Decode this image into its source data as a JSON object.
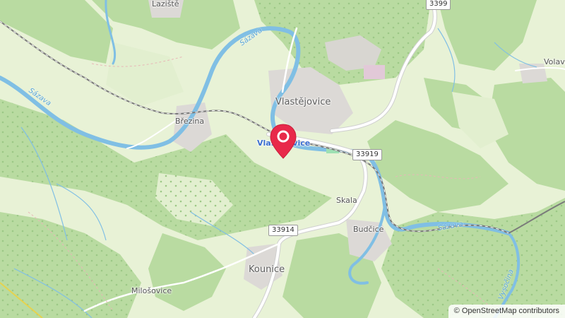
{
  "labels": {
    "lazite": "Laziště",
    "brezina": "Březina",
    "vlastejovice": "Vlastějovice",
    "vlastejovice_poi": "Vlastějovice",
    "skala": "Skala",
    "budcice": "Budčice",
    "kounice": "Kounice",
    "milosovice": "Milošovice",
    "volava": "Volava"
  },
  "rivers": {
    "sazava_top": "Sázava",
    "sazava_left": "Sázava",
    "sazava_right": "Sázava",
    "vysocina": "Vysočina"
  },
  "roads": {
    "r3399": "3399",
    "r33919": "33919",
    "r33914": "33914"
  },
  "attribution": "© OpenStreetMap contributors",
  "colors": {
    "forest": "#b5d99c",
    "meadow": "#e8f2d6",
    "water": "#80bfe4",
    "road": "#ffffff",
    "marker": "#e8294a"
  }
}
